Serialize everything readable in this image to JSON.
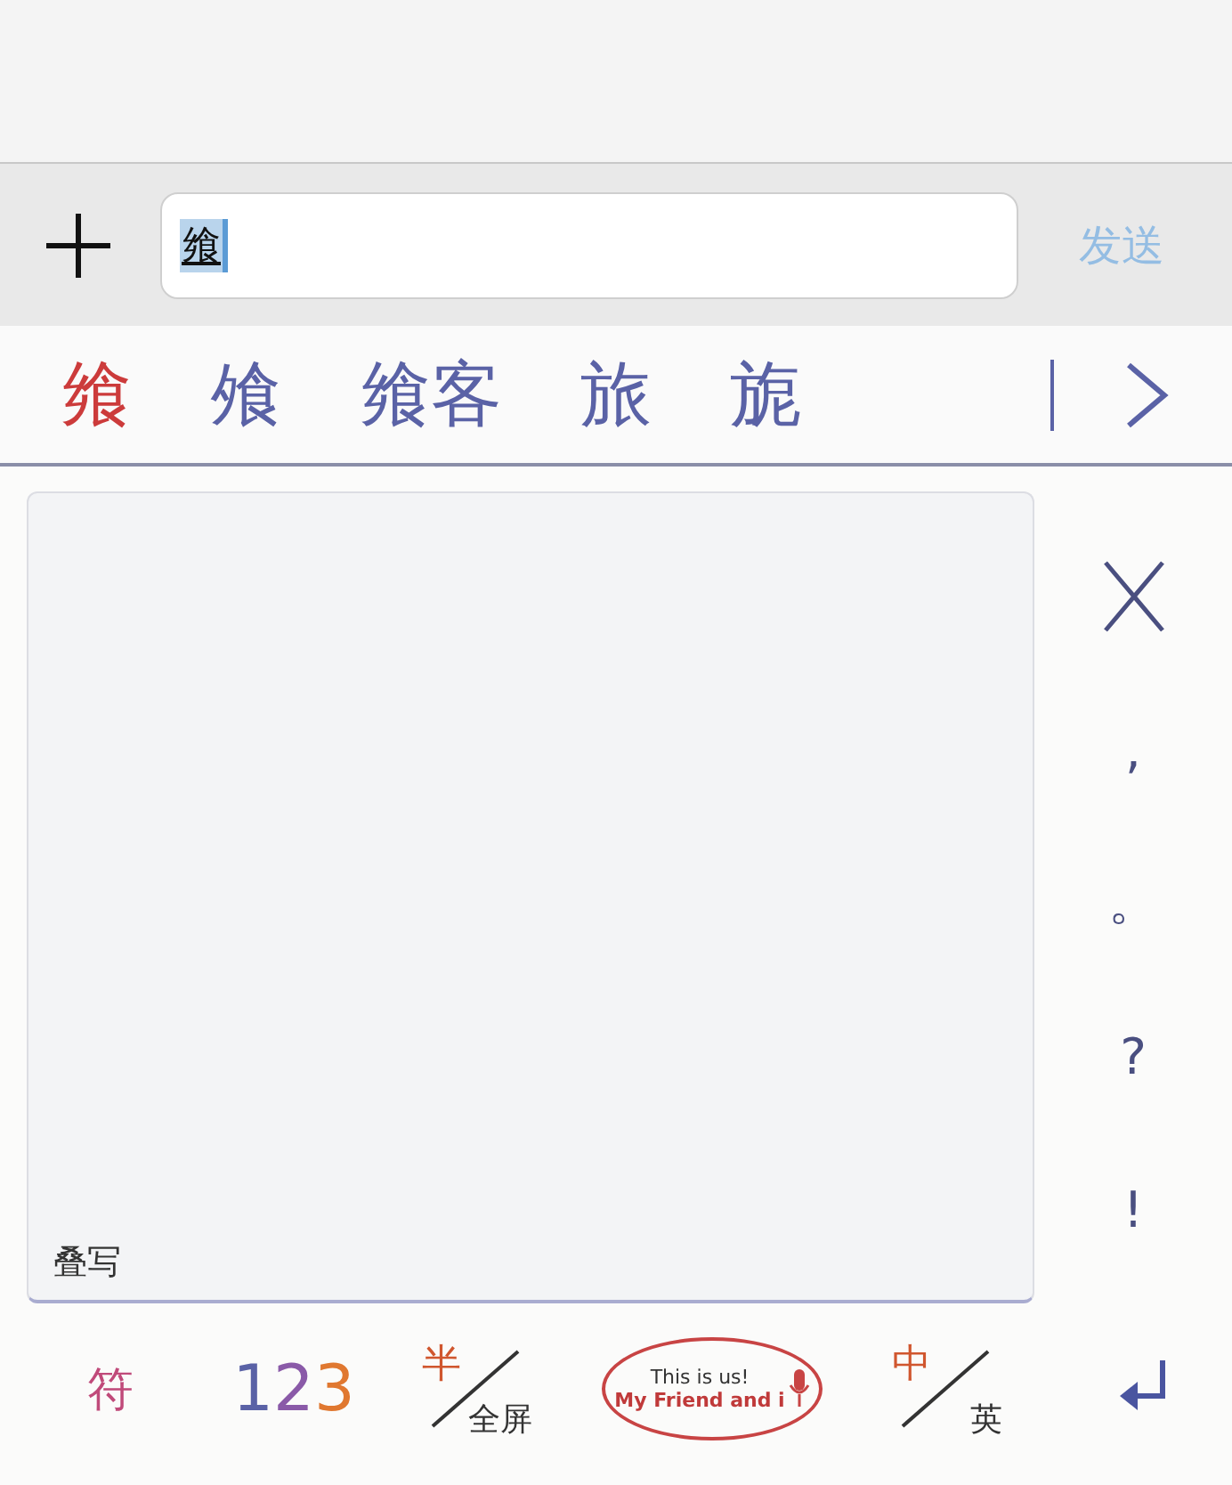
{
  "input_bar": {
    "field_value": "飨",
    "value_selected": true,
    "send_label": "发送"
  },
  "candidates": [
    {
      "text": "飨",
      "selected": true
    },
    {
      "text": "飧",
      "selected": false
    },
    {
      "text": "飨客",
      "selected": false
    },
    {
      "text": "旅",
      "selected": false
    },
    {
      "text": "旎",
      "selected": false
    }
  ],
  "handwriting_pad": {
    "mode_label": "叠写"
  },
  "side_keys": [
    {
      "kind": "delete"
    },
    {
      "kind": "char",
      "label": ","
    },
    {
      "kind": "char",
      "label": "。"
    },
    {
      "kind": "char",
      "label": "?"
    },
    {
      "kind": "char",
      "label": "!"
    }
  ],
  "bottom_keys": [
    {
      "kind": "symbol",
      "label": "符"
    },
    {
      "kind": "number",
      "label": "123"
    },
    {
      "kind": "split",
      "top": "半",
      "bottom": "全屏"
    },
    {
      "kind": "badge",
      "line1": "This is us!",
      "line2": "My Friend and i"
    },
    {
      "kind": "split",
      "top": "中",
      "bottom": "英"
    },
    {
      "kind": "enter"
    }
  ]
}
